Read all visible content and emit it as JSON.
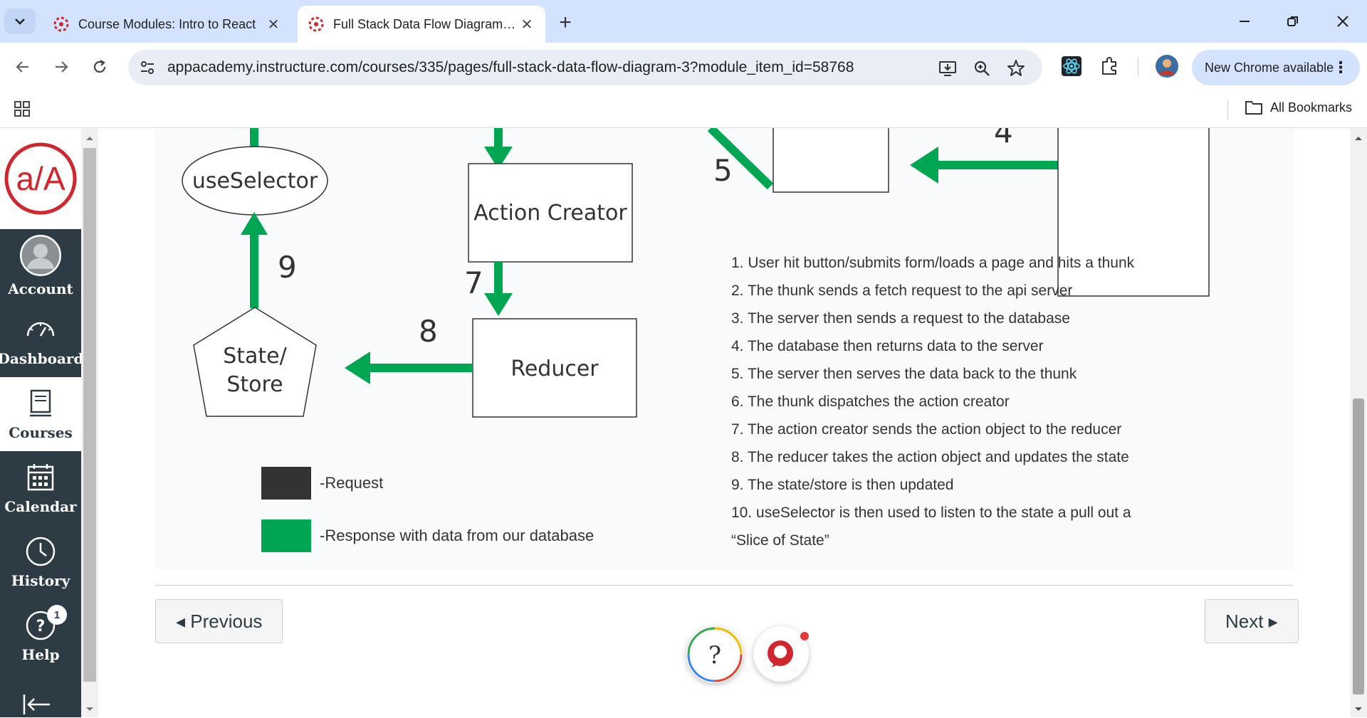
{
  "browser": {
    "tabs": [
      {
        "title": "Course Modules: Intro to React",
        "active": false
      },
      {
        "title": "Full Stack Data Flow Diagram: Intro to React",
        "active": true
      }
    ],
    "url": "appacademy.instructure.com/courses/335/pages/full-stack-data-flow-diagram-3?module_item_id=58768",
    "new_chrome_label": "New Chrome available",
    "all_bookmarks_label": "All Bookmarks"
  },
  "sidebar": {
    "logo_text": "a/A",
    "items": [
      {
        "label": "Account",
        "icon": "account-icon"
      },
      {
        "label": "Dashboard",
        "icon": "dashboard-icon"
      },
      {
        "label": "Courses",
        "icon": "courses-icon",
        "active": true
      },
      {
        "label": "Calendar",
        "icon": "calendar-icon"
      },
      {
        "label": "History",
        "icon": "history-icon"
      },
      {
        "label": "Help",
        "icon": "help-icon",
        "badge": "1"
      }
    ]
  },
  "diagram": {
    "nodes": {
      "use_selector": "useSelector",
      "action_creator": "Action Creator",
      "reducer": "Reducer",
      "state_line1": "State/",
      "state_line2": "Store"
    },
    "arrow_labels": {
      "n4": "4",
      "n5": "5",
      "n7": "7",
      "n8": "8",
      "n9": "9"
    },
    "steps": [
      "1. User hit button/submits form/loads a page and hits a thunk",
      "2. The thunk sends a fetch request to the api server",
      "3. The server then sends a request to the database",
      "4. The database then returns data to the server",
      "5. The server then serves the data back to the thunk",
      "6. The thunk dispatches the action creator",
      "7. The action creator sends the action object to the reducer",
      "8. The reducer takes the action object and updates the state",
      "9. The state/store is then updated",
      "10. useSelector is then used to listen to the state a pull out a",
      "“Slice of State”"
    ],
    "legend": [
      {
        "label": "-Request",
        "color": "#333333"
      },
      {
        "label": "-Response with data from our database",
        "color": "#00a651"
      }
    ],
    "arrow_color": "#00a651"
  },
  "pagination": {
    "previous_label": "◂ Previous",
    "next_label": "Next ▸"
  },
  "colors": {
    "sidebar_bg": "#2d3b45",
    "brand_red": "#d0262e"
  }
}
